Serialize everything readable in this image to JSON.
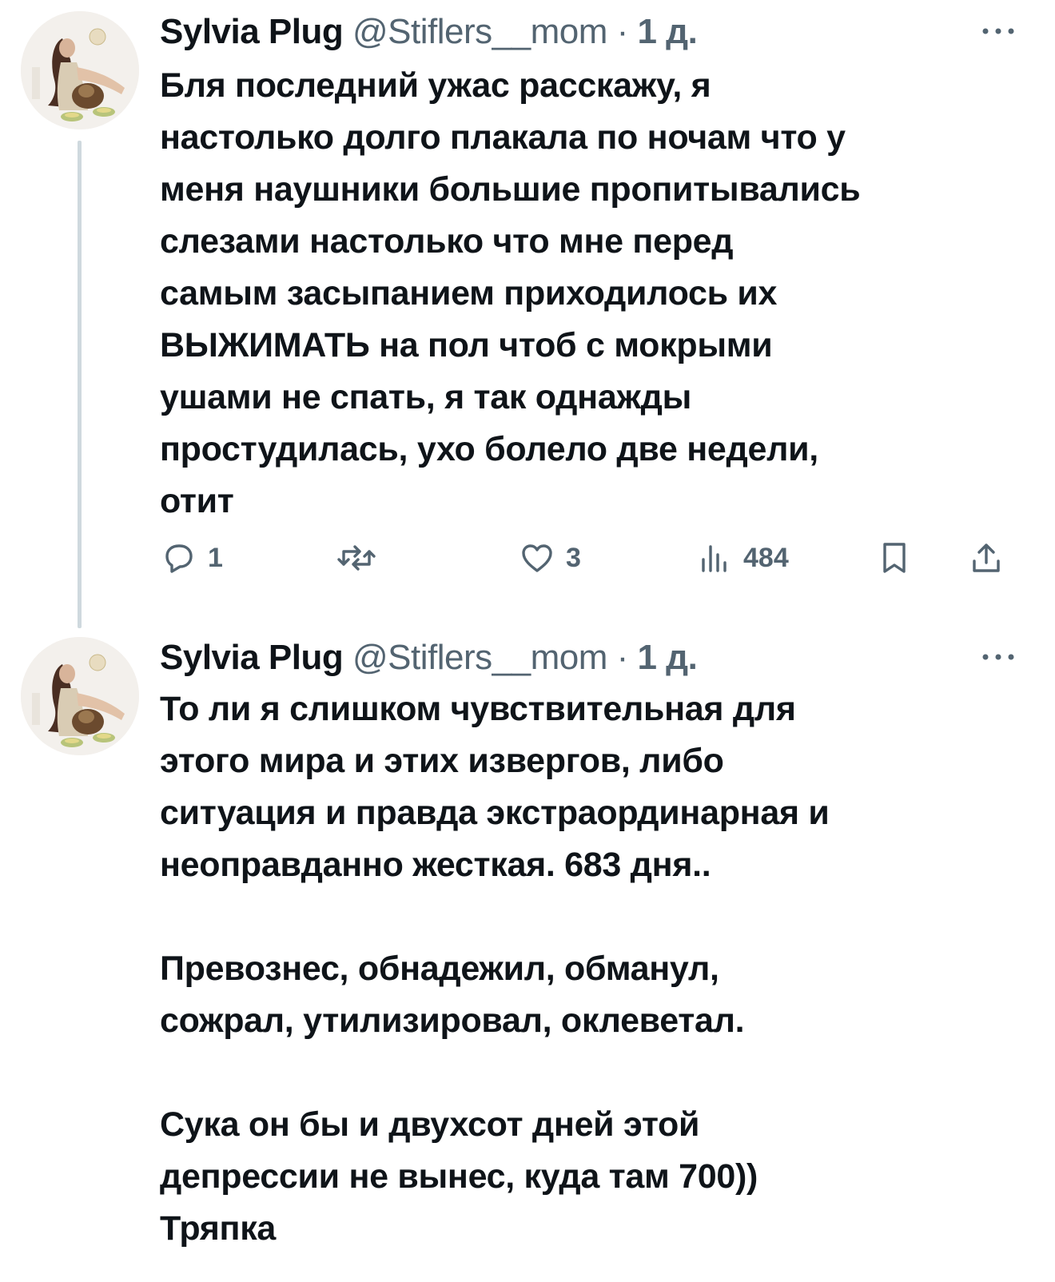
{
  "tweets": [
    {
      "author": {
        "name": "Sylvia Plug",
        "handle": "@Stiflers__mom",
        "separator": "·",
        "time": "1 д."
      },
      "text": "Бля последний ужас расскажу, я\nнастолько долго плакала по ночам что у\nменя наушники большие пропитывались\nслезами настолько что мне перед\nсамым засыпанием приходилось их\nВЫЖИМАТЬ на пол чтоб с мокрыми\nушами не спать, я так однажды\nпростудилась, ухо болело две недели,\nотит",
      "actions": {
        "reply_count": "1",
        "like_count": "3",
        "view_count": "484"
      }
    },
    {
      "author": {
        "name": "Sylvia Plug",
        "handle": "@Stiflers__mom",
        "separator": "·",
        "time": "1 д."
      },
      "text": "То ли я слишком чувствительная для\nэтого мира и этих извергов, либо\nситуация и правда экстраординарная и\nнеоправданно жесткая. 683 дня..\n\nПревознес, обнадежил, обманул,\nсожрал, утилизировал, оклеветал.\n\nСука он бы и двухсот дней этой\nдепрессии не вынес, куда там 700))\nТряпка"
    }
  ],
  "icons": {
    "more": "more-horizontal-icon",
    "reply": "reply-bubble-icon",
    "retweet": "retweet-icon",
    "like": "heart-icon",
    "views": "bar-chart-icon",
    "bookmark": "bookmark-icon",
    "share": "share-icon"
  },
  "colors": {
    "text_primary": "#0f1419",
    "text_secondary": "#536471",
    "thread_line": "#cfd9de"
  }
}
